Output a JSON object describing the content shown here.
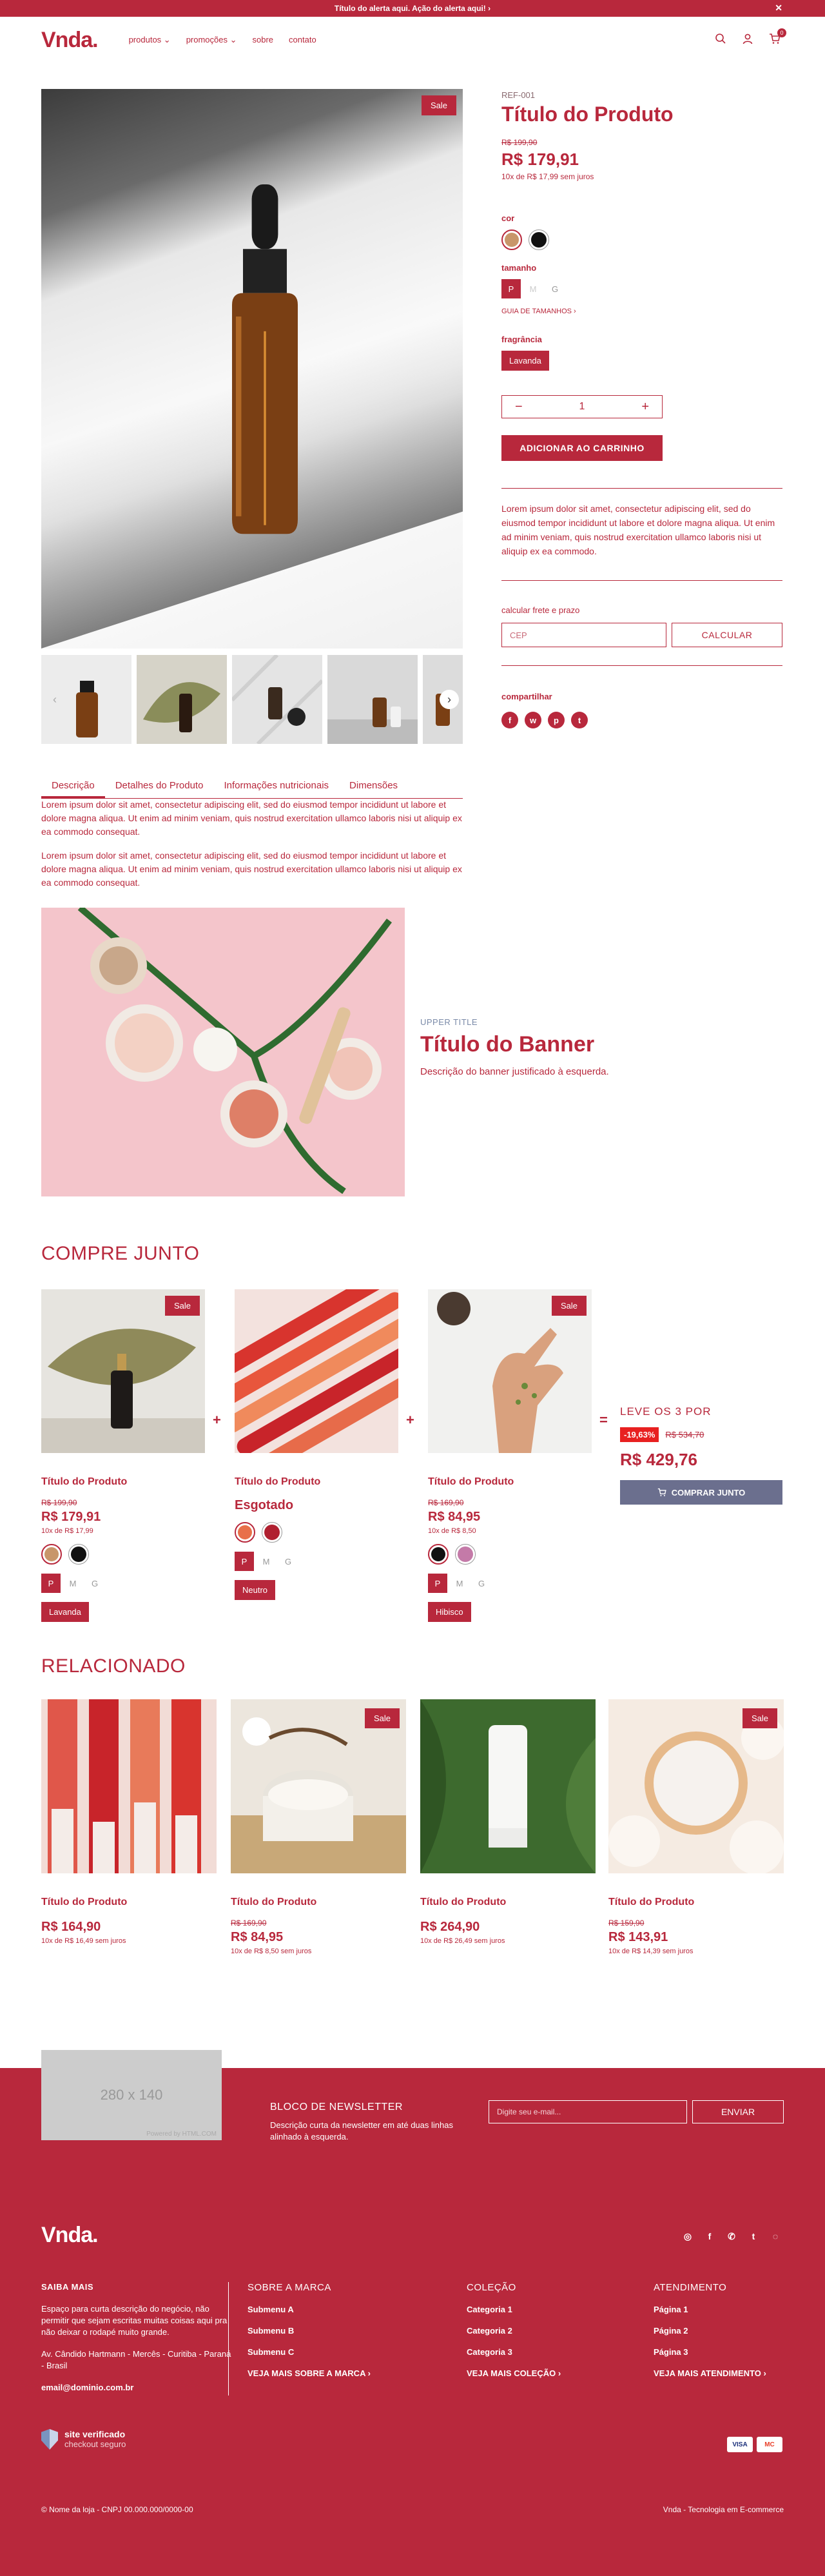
{
  "alert": {
    "text": "Título do alerta aqui. Ação do alerta aqui! ›",
    "close": "✕"
  },
  "header": {
    "logo": "Vnda.",
    "nav": [
      "produtos ⌄",
      "promoções ⌄",
      "sobre",
      "contato"
    ],
    "cart_count": "0"
  },
  "product": {
    "sale_label": "Sale",
    "ref": "REF-001",
    "title": "Título do Produto",
    "old_price": "R$ 199,90",
    "price": "R$ 179,91",
    "installments": "10x de R$ 17,99 sem juros",
    "color_label": "cor",
    "colors": [
      "#c8966a",
      "#111111"
    ],
    "size_label": "tamanho",
    "sizes": [
      "P",
      "M",
      "G"
    ],
    "size_guide": "GUIA DE TAMANHOS  ›",
    "fragrance_label": "fragrância",
    "fragrance": "Lavanda",
    "quantity": "1",
    "qty_minus": "−",
    "qty_plus": "+",
    "add_to_cart": "ADICIONAR AO CARRINHO",
    "short_desc": "Lorem ipsum dolor sit amet, consectetur adipiscing elit, sed do eiusmod tempor incididunt ut labore et dolore magna aliqua. Ut enim ad minim veniam, quis nostrud exercitation ullamco laboris nisi ut aliquip ex ea commodo.",
    "shipping_label": "calcular frete e prazo",
    "cep_placeholder": "CEP",
    "calculate": "CALCULAR",
    "share_label": "compartilhar",
    "share_icons": [
      "f",
      "w",
      "p",
      "t"
    ],
    "tabs": [
      "Descrição",
      "Detalhes do Produto",
      "Informações nutricionais",
      "Dimensões"
    ],
    "description": [
      "Lorem ipsum dolor sit amet, consectetur adipiscing elit, sed do eiusmod tempor incididunt ut labore et dolore magna aliqua. Ut enim ad minim veniam, quis nostrud exercitation ullamco laboris nisi ut aliquip ex ea commodo consequat.",
      "Lorem ipsum dolor sit amet, consectetur adipiscing elit, sed do eiusmod tempor incididunt ut labore et dolore magna aliqua. Ut enim ad minim veniam, quis nostrud exercitation ullamco laboris nisi ut aliquip ex ea commodo consequat."
    ],
    "thumb_prev": "‹",
    "thumb_next": "›"
  },
  "banner": {
    "upper_title": "UPPER TITLE",
    "title": "Título do Banner",
    "description": "Descrição do banner justificado à esquerda."
  },
  "buy_together": {
    "title": "COMPRE JUNTO",
    "plus": "+",
    "equals": "=",
    "products": [
      {
        "sale": "Sale",
        "title": "Título do Produto",
        "old_price": "R$ 199,90",
        "price": "R$ 179,91",
        "installments": "10x de R$ 17,99",
        "colors": [
          "#c8966a",
          "#111111"
        ],
        "sizes": [
          "P",
          "M",
          "G"
        ],
        "variant": "Lavanda"
      },
      {
        "sale": "",
        "title": "Título do Produto",
        "status": "Esgotado",
        "colors": [
          "#e8704a",
          "#b02030"
        ],
        "sizes": [
          "P",
          "M",
          "G"
        ],
        "variant": "Neutro"
      },
      {
        "sale": "Sale",
        "title": "Título do Produto",
        "old_price": "R$ 169,90",
        "price": "R$ 84,95",
        "installments": "10x de R$ 8,50",
        "colors": [
          "#111111",
          "#c47aa8"
        ],
        "sizes": [
          "P",
          "M",
          "G"
        ],
        "variant": "Hibisco"
      }
    ],
    "offer": "LEVE OS 3 POR",
    "discount": "-19,63%",
    "total_old": "R$ 534,70",
    "total": "R$ 429,76",
    "buy_button": "COMPRAR JUNTO",
    "cart_icon": "🛒"
  },
  "related": {
    "title": "RELACIONADO",
    "products": [
      {
        "sale": "",
        "title": "Título do Produto",
        "old_price": "",
        "price": "R$ 164,90",
        "installments": "10x de R$ 16,49 sem juros"
      },
      {
        "sale": "Sale",
        "title": "Título do Produto",
        "old_price": "R$ 169,90",
        "price": "R$ 84,95",
        "installments": "10x de R$ 8,50 sem juros"
      },
      {
        "sale": "",
        "title": "Título do Produto",
        "old_price": "",
        "price": "R$ 264,90",
        "installments": "10x de R$ 26,49 sem juros"
      },
      {
        "sale": "Sale",
        "title": "Título do Produto",
        "old_price": "R$ 159,90",
        "price": "R$ 143,91",
        "installments": "10x de R$ 14,39 sem juros"
      }
    ]
  },
  "newsletter": {
    "placeholder_image": "280 x 140",
    "placeholder_credit": "Powered by HTML.COM",
    "title": "BLOCO DE NEWSLETTER",
    "description": "Descrição curta da newsletter em até duas linhas alinhado à esquerda.",
    "email_placeholder": "Digite seu e-mail...",
    "submit": "ENVIAR"
  },
  "footer": {
    "logo": "Vnda.",
    "social": [
      "◎",
      "f",
      "✆",
      "t",
      "◌"
    ],
    "about_title": "SAIBA MAIS",
    "about_text": "Espaço para curta descrição do negócio, não permitir que sejam escritas muitas coisas aqui pra não deixar o rodapé muito grande.",
    "address": "Av. Cândido Hartmann - Mercês - Curitiba - Paraná - Brasil",
    "email": "email@dominio.com.br",
    "columns": [
      {
        "title": "SOBRE A MARCA",
        "links": [
          "Submenu A",
          "Submenu B",
          "Submenu C",
          "VEJA MAIS SOBRE A MARCA  ›"
        ]
      },
      {
        "title": "COLEÇÃO",
        "links": [
          "Categoria 1",
          "Categoria 2",
          "Categoria 3",
          "VEJA MAIS COLEÇÃO  ›"
        ]
      },
      {
        "title": "ATENDIMENTO",
        "links": [
          "Página 1",
          "Página 2",
          "Página 3",
          "VEJA MAIS ATENDIMENTO  ›"
        ]
      }
    ],
    "seal_title": "site verificado",
    "seal_sub": "checkout seguro",
    "payment": [
      "VISA",
      "MC"
    ],
    "copyright": "© Nome da loja - CNPJ 00.000.000/0000-00",
    "credit": "Vnda - Tecnologia em E-commerce"
  }
}
